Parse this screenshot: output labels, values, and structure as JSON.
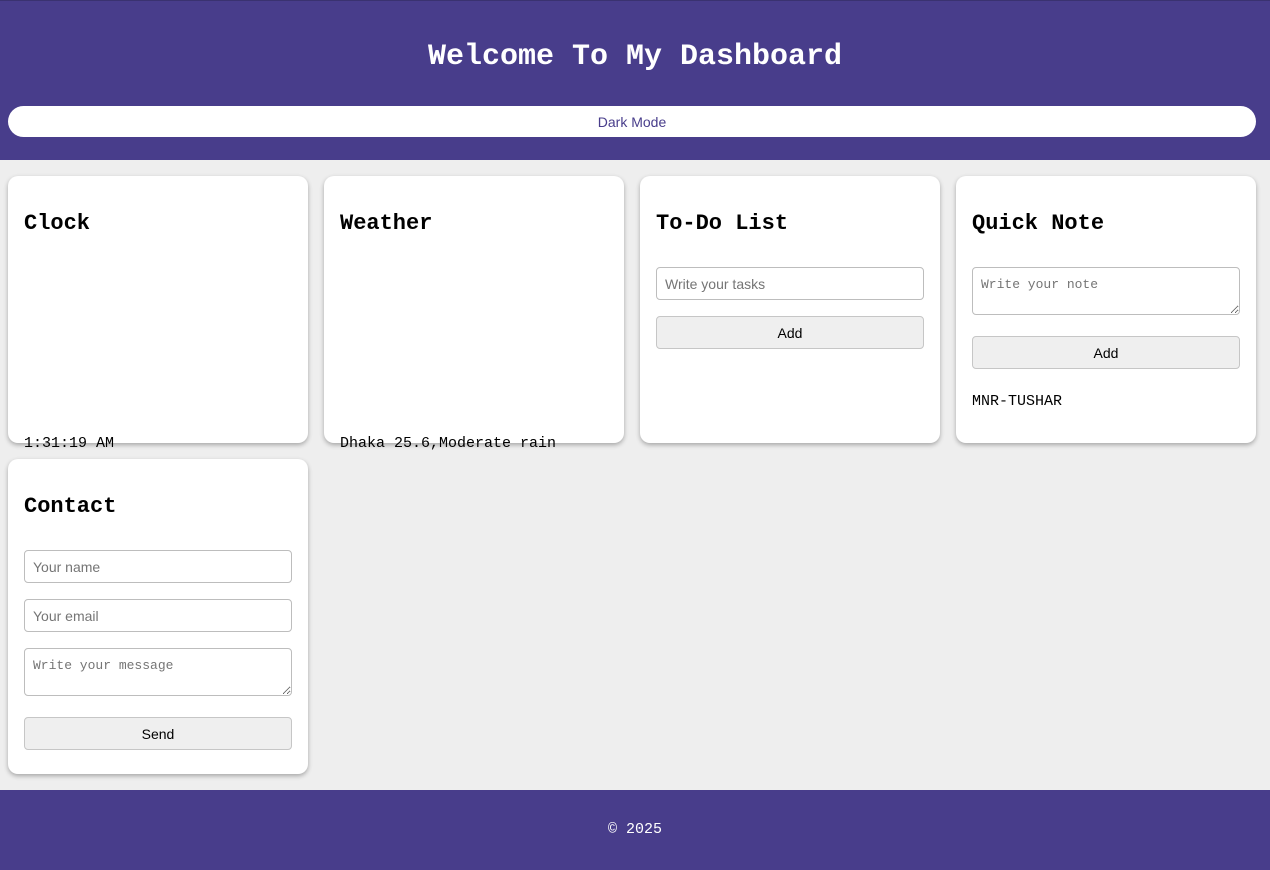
{
  "header": {
    "title": "Welcome To My Dashboard",
    "mode_toggle_label": "Dark Mode"
  },
  "clock": {
    "title": "Clock",
    "time": "1:31:19 AM"
  },
  "weather": {
    "title": "Weather",
    "summary": "Dhaka 25.6,Moderate rain"
  },
  "todo": {
    "title": "To-Do List",
    "task_input": {
      "value": "",
      "placeholder": "Write your tasks"
    },
    "add_label": "Add"
  },
  "quick_note": {
    "title": "Quick Note",
    "note_input": {
      "value": "",
      "placeholder": "Write your note"
    },
    "add_label": "Add",
    "saved_note": "MNR-TUSHAR"
  },
  "contact": {
    "title": "Contact",
    "name_input": {
      "value": "",
      "placeholder": "Your name"
    },
    "email_input": {
      "value": "",
      "placeholder": "Your email"
    },
    "message_input": {
      "value": "",
      "placeholder": "Write your message"
    },
    "send_label": "Send"
  },
  "footer": {
    "copyright": "© 2025"
  },
  "colors": {
    "brand": "#483d8b",
    "background": "#eeeeee",
    "card": "#ffffff"
  }
}
